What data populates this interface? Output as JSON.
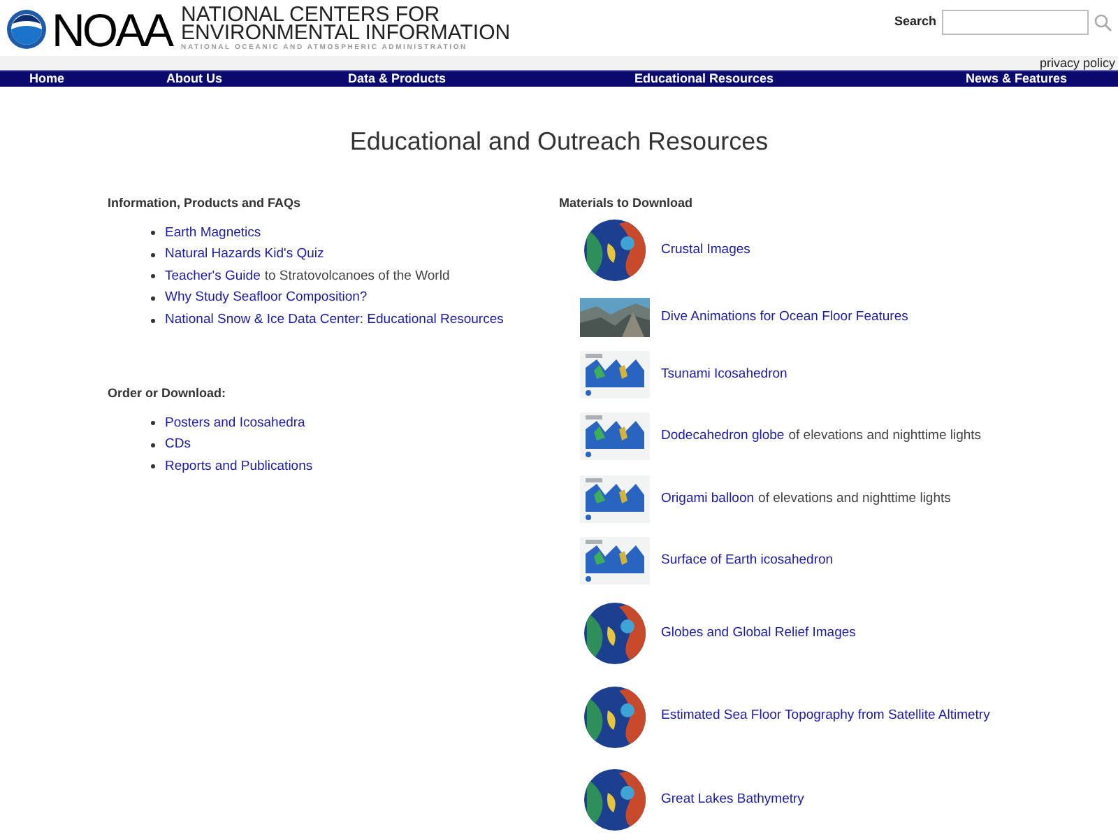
{
  "header": {
    "logo_word": "NOAA",
    "center_lines": [
      "NATIONAL CENTERS FOR",
      "ENVIRONMENTAL INFORMATION"
    ],
    "subtitle": "NATIONAL OCEANIC AND ATMOSPHERIC ADMINISTRATION",
    "search": {
      "label": "Search"
    },
    "privacy": "privacy policy"
  },
  "nav": [
    "Home",
    "About Us",
    "Data & Products",
    "Educational Resources",
    "News & Features"
  ],
  "title": "Educational and Outreach Resources",
  "left_sections": [
    {
      "heading": "Information, Products and FAQs",
      "items": [
        {
          "link": "Earth Magnetics"
        },
        {
          "link": "Natural Hazards Kid's Quiz"
        },
        {
          "link": "Teacher's Guide",
          "rest": "to Stratovolcanoes of the World"
        },
        {
          "link": "Why Study Seafloor Composition?"
        },
        {
          "link": "National Snow & Ice Data Center: Educational Resources"
        }
      ]
    },
    {
      "heading": "Order or Download:",
      "items": [
        {
          "link": "Posters and Icosahedra"
        },
        {
          "link": "CDs"
        },
        {
          "link": "Reports and Publications"
        }
      ]
    }
  ],
  "materials": {
    "heading": "Materials to Download",
    "items": [
      {
        "kind": "globe",
        "link": "Crustal Images"
      },
      {
        "link": "Dive Animations for Ocean Floor Features"
      },
      {
        "kind": "poster",
        "link": "Tsunami Icosahedron"
      },
      {
        "kind": "poster",
        "link": "Dodecahedron globe",
        "rest": "of elevations and nighttime lights"
      },
      {
        "kind": "poster",
        "link": "Origami balloon",
        "rest": "of elevations and nighttime lights"
      },
      {
        "kind": "poster",
        "link": "Surface of Earth icosahedron"
      },
      {
        "kind": "globe",
        "link": "Globes and Global Relief Images"
      },
      {
        "kind": "globe",
        "link": "Estimated Sea Floor Topography from Satellite Altimetry"
      },
      {
        "kind": "globe",
        "link": "Great Lakes Bathymetry"
      }
    ]
  }
}
